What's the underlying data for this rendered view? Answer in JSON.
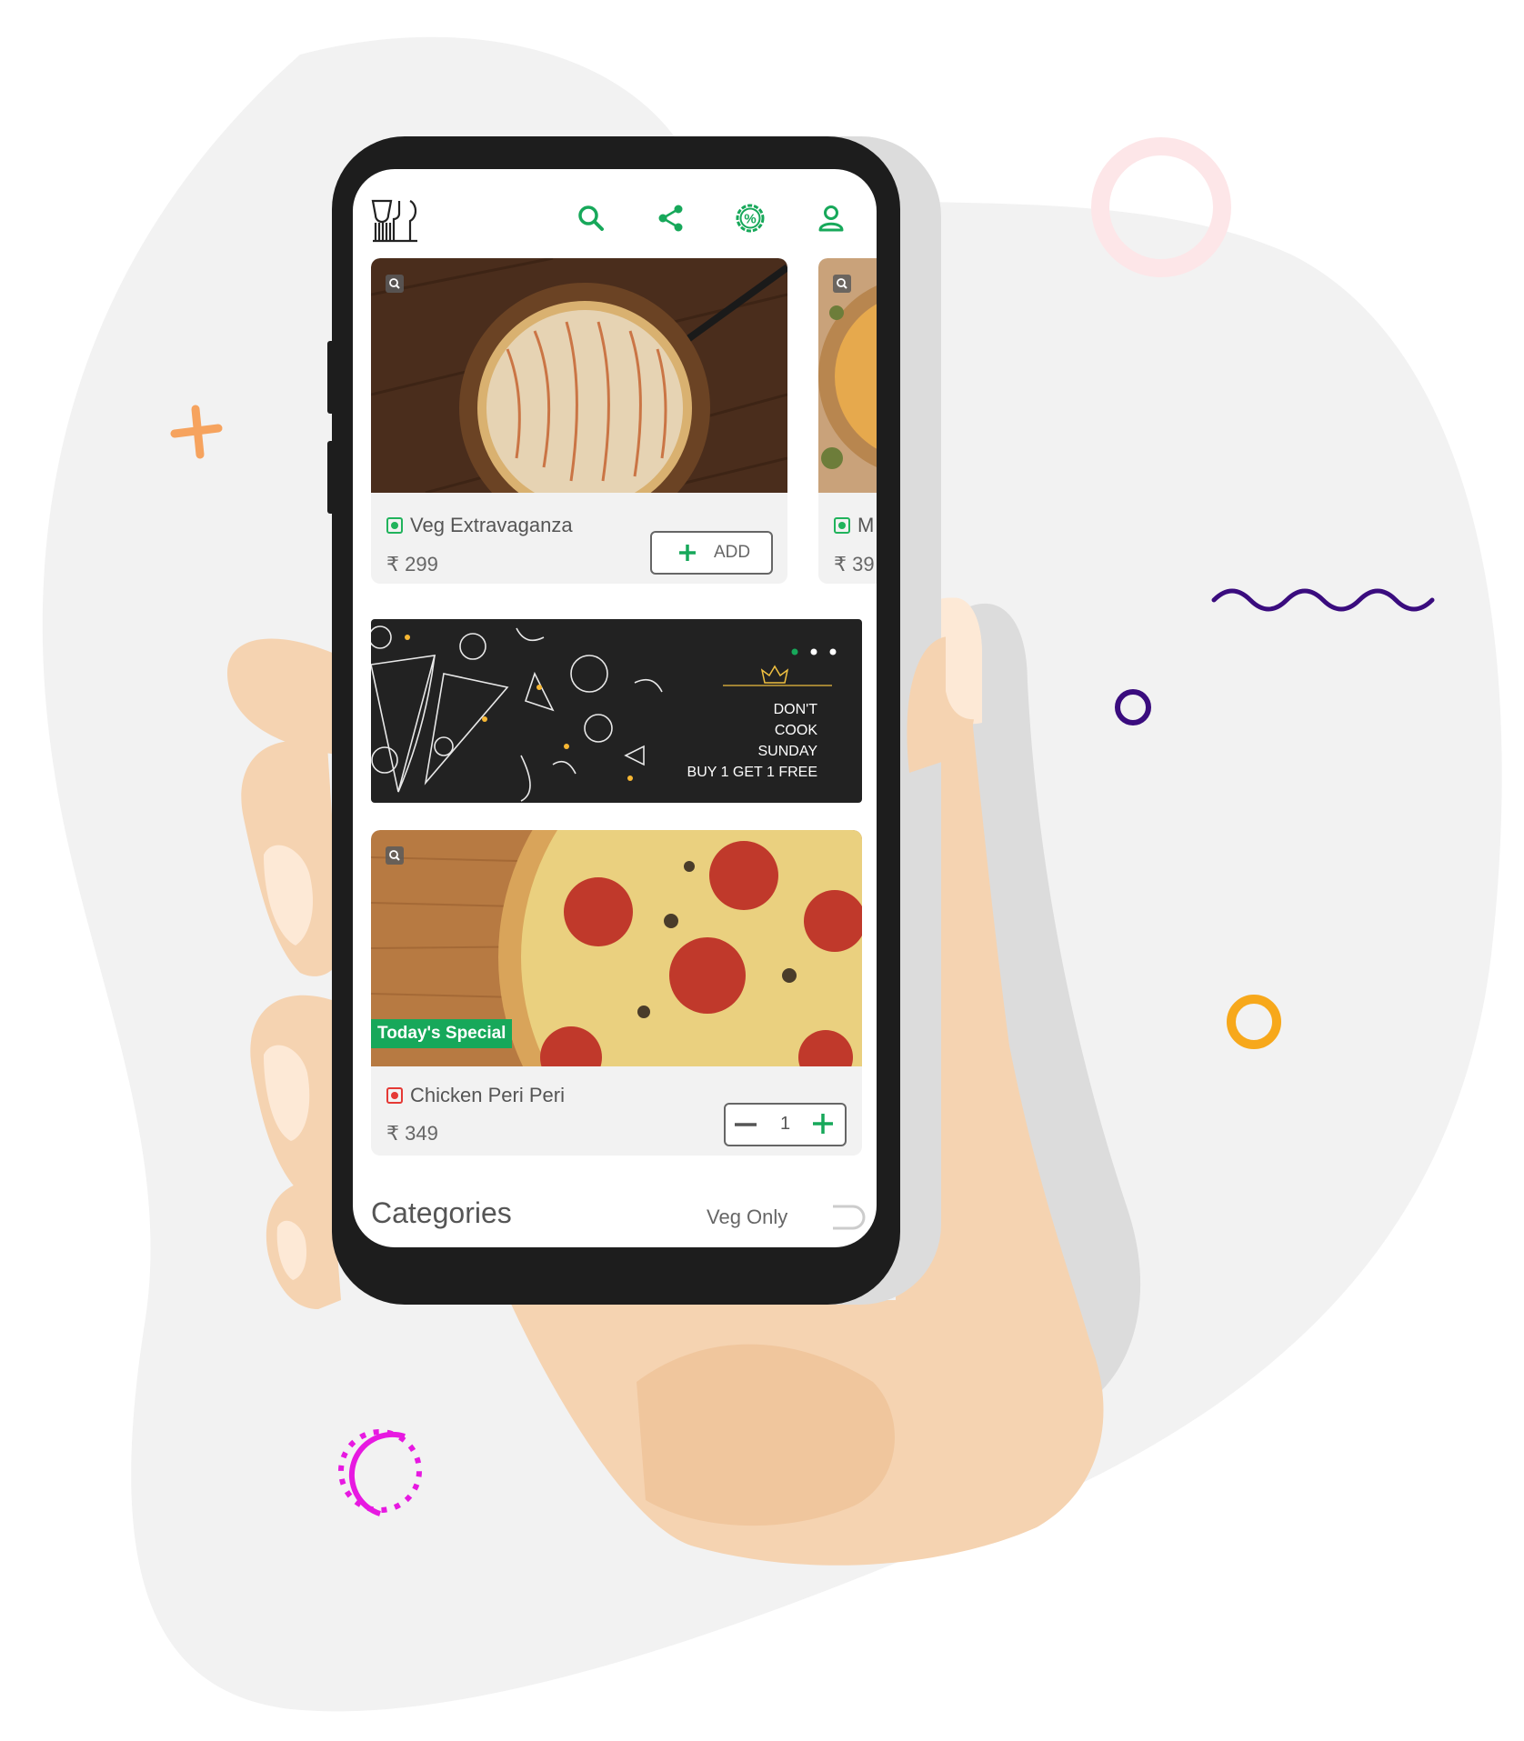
{
  "header": {
    "logo": "restaurant-logo",
    "icons": [
      "search-icon",
      "share-icon",
      "discount-icon",
      "profile-icon"
    ]
  },
  "items": [
    {
      "name": "Veg Extravaganza",
      "price": "₹ 299",
      "type": "veg",
      "action": "ADD"
    },
    {
      "name": "M",
      "price": "₹ 39",
      "type": "veg"
    },
    {
      "name": "Chicken Peri Peri",
      "price": "₹ 349",
      "type": "non-veg",
      "quantity": "1",
      "tag": "Today's Special"
    }
  ],
  "banner": {
    "line1": "DON'T",
    "line2": "COOK",
    "line3": "SUNDAY",
    "line4": "BUY 1 GET 1 FREE"
  },
  "categories": {
    "title": "Categories",
    "filter_label": "Veg Only",
    "toggle": "off"
  },
  "colors": {
    "accent": "#17a85a",
    "phone": "#1d1d1d",
    "skin": "#f5d3b1",
    "nonveg": "#e53935"
  }
}
